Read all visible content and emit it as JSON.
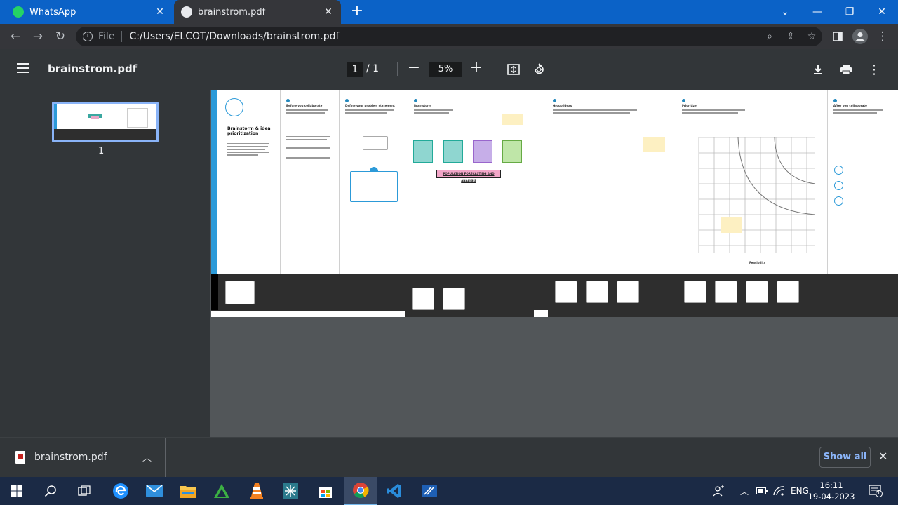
{
  "tabs": [
    {
      "label": "WhatsApp",
      "active": false
    },
    {
      "label": "brainstrom.pdf",
      "active": true
    }
  ],
  "address": {
    "scheme": "File",
    "url": "C:/Users/ELCOT/Downloads/brainstrom.pdf"
  },
  "viewer": {
    "title": "brainstrom.pdf",
    "page_current": "1",
    "page_total": "/  1",
    "zoom": "5%"
  },
  "thumbnail": {
    "page_number": "1"
  },
  "document": {
    "panels": [
      {
        "heading": "Brainstorm & idea prioritization"
      },
      {
        "heading": "Before you collaborate"
      },
      {
        "heading": "Define your problem statement"
      },
      {
        "heading": "Brainstorm"
      },
      {
        "heading": "Group ideas"
      },
      {
        "heading": "Prioritize"
      },
      {
        "heading": "After you collaborate"
      }
    ],
    "banner": "POPULATION FORECASTING AND ANALYSIS",
    "axis_label": "Feasibility"
  },
  "downloads": {
    "file": "brainstrom.pdf",
    "show_all": "Show all"
  },
  "taskbar": {
    "lang": "ENG",
    "time": "16:11",
    "date": "19-04-2023",
    "notifications": "1"
  },
  "colors": {
    "tab_strip": "#0b62c7",
    "toolbar": "#35363a",
    "pdf_bar": "#323639",
    "viewer_bg": "#525659",
    "accent": "#8ab4f8",
    "taskbar": "#1b2a45"
  }
}
